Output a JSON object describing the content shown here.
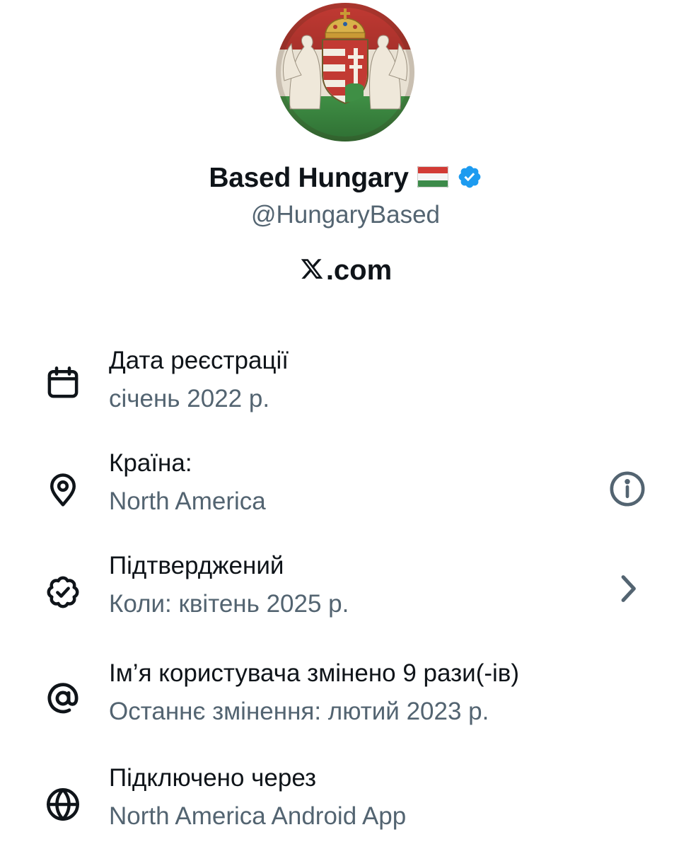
{
  "profile": {
    "display_name": "Based Hungary",
    "flag_icon": "hungary-flag-icon",
    "verified_icon": "verified-badge-icon",
    "verified_color": "#1d9bf0",
    "handle": "@HungaryBased",
    "site_label": ".com",
    "site_logo_icon": "x-logo-icon"
  },
  "about": {
    "rows": [
      {
        "icon": "calendar-icon",
        "title": "Дата реєстрації",
        "subtitle": "січень 2022 р."
      },
      {
        "icon": "location-pin-icon",
        "title": "Країна:",
        "subtitle": "North America",
        "action_icon": "info-icon"
      },
      {
        "icon": "verified-check-icon",
        "title": "Підтверджений",
        "subtitle": "Коли: квітень 2025 р.",
        "action_icon": "chevron-right-icon"
      },
      {
        "icon": "at-sign-icon",
        "title": "Ім’я користувача змінено 9 рази(-ів)",
        "subtitle": "Останнє змінення: лютий 2023 р."
      },
      {
        "icon": "globe-icon",
        "title": "Підключено через",
        "subtitle": "North America Android App"
      }
    ]
  },
  "colors": {
    "text_primary": "#0f1419",
    "text_secondary": "#536471",
    "flag_red": "#c8102e",
    "flag_green": "#2e7d32"
  }
}
